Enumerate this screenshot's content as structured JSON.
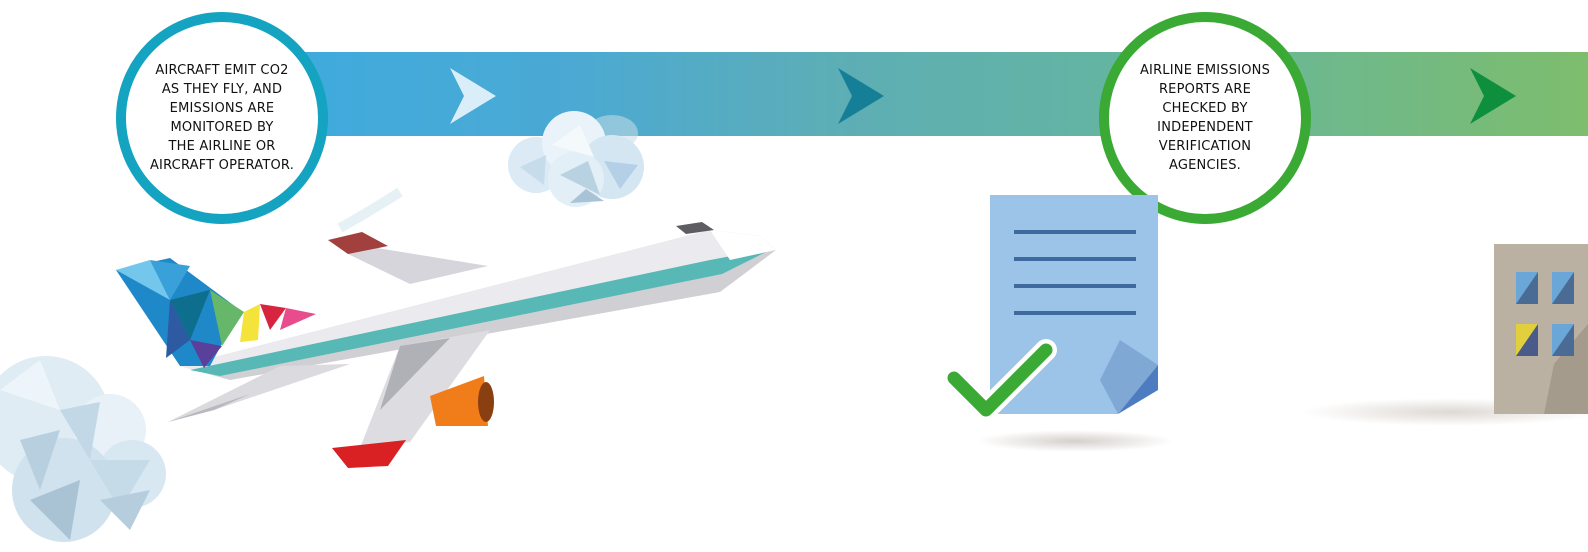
{
  "steps": [
    {
      "lines": [
        "AIRCRAFT EMIT CO2",
        "AS THEY FLY, AND",
        "EMISSIONS ARE",
        "MONITORED BY",
        "THE AIRLINE OR",
        "AIRCRAFT OPERATOR."
      ],
      "color": "#14a3c0"
    },
    {
      "lines": [
        "AIRLINE EMISSIONS",
        "REPORTS ARE",
        "CHECKED BY",
        "INDEPENDENT",
        "VERIFICATION",
        "AGENCIES."
      ],
      "color": "#3aaa35"
    }
  ],
  "colors": {
    "band_start": "#3dabe0",
    "band_end": "#7dbd6d",
    "arrow_1": "#d9eef8",
    "arrow_2": "#167f98",
    "arrow_3": "#0d8f3e",
    "checkmark": "#3aaa35",
    "document": "#9cc3e8",
    "engine": "#f07d1a"
  },
  "icons": [
    "airplane-icon",
    "cloud-icon",
    "document-icon",
    "checkmark-icon",
    "building-icon"
  ]
}
